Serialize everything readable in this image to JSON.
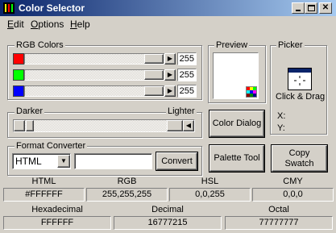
{
  "window": {
    "title": "Color Selector",
    "controls": [
      "minimize",
      "maximize",
      "close"
    ]
  },
  "menu": [
    {
      "label": "Edit",
      "accel": "E"
    },
    {
      "label": "Options",
      "accel": "O"
    },
    {
      "label": "Help",
      "accel": "H"
    }
  ],
  "rgb": {
    "label": "RGB Colors",
    "channels": [
      {
        "name": "red",
        "color": "#ff0000",
        "value": "255",
        "level": 1.0
      },
      {
        "name": "green",
        "color": "#00ff00",
        "value": "255",
        "level": 1.0
      },
      {
        "name": "blue",
        "color": "#0000ff",
        "value": "255",
        "level": 1.0
      }
    ]
  },
  "brightness": {
    "darker_label": "Darker",
    "lighter_label": "Lighter",
    "level": 0.0
  },
  "preview": {
    "label": "Preview",
    "color": "#ffffff"
  },
  "picker": {
    "label": "Picker",
    "action_label": "Click & Drag",
    "x_label": "X:",
    "y_label": "Y:"
  },
  "format_converter": {
    "label": "Format Converter",
    "format_selected": "HTML",
    "input_value": "",
    "convert_button": "Convert"
  },
  "buttons": {
    "color_dialog": "Color Dialog",
    "palette_tool": "Palette Tool",
    "copy_swatch_line1": "Copy",
    "copy_swatch_line2": "Swatch"
  },
  "outputs_row1": [
    {
      "label": "HTML",
      "value": "#FFFFFF"
    },
    {
      "label": "RGB",
      "value": "255,255,255"
    },
    {
      "label": "HSL",
      "value": "0,0,255"
    },
    {
      "label": "CMY",
      "value": "0,0,0"
    }
  ],
  "outputs_row2": [
    {
      "label": "Hexadecimal",
      "value": "FFFFFF"
    },
    {
      "label": "Decimal",
      "value": "16777215"
    },
    {
      "label": "Octal",
      "value": "77777777"
    }
  ]
}
